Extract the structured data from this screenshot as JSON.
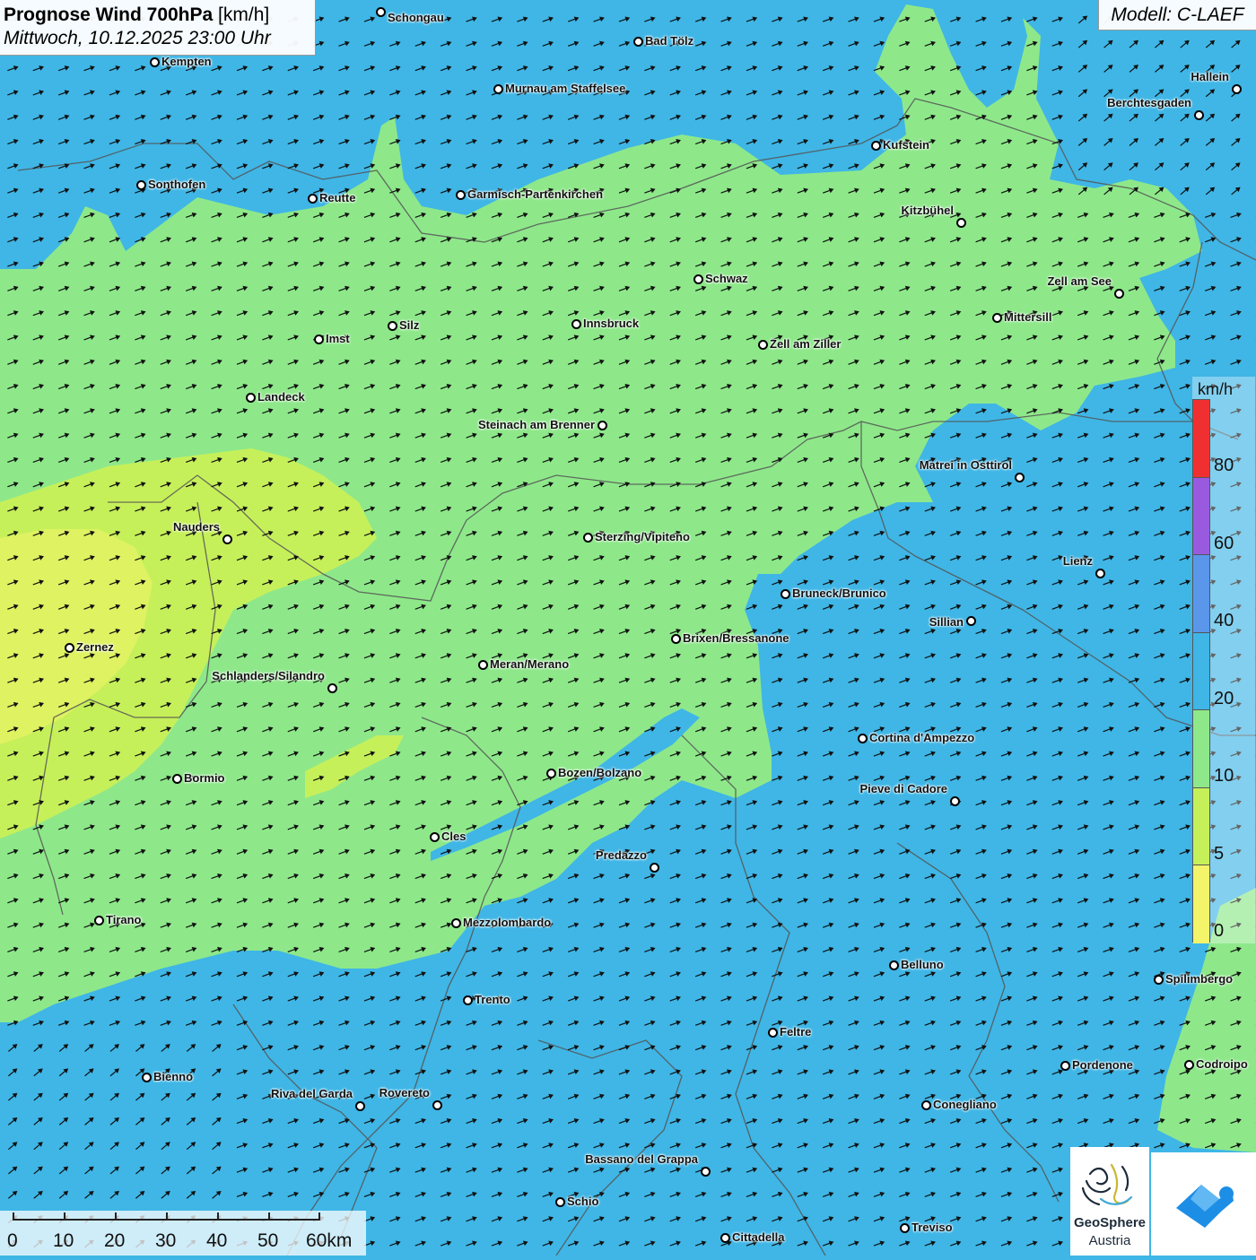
{
  "title": {
    "main": "Prognose Wind 700hPa",
    "unit": "[km/h]",
    "datetime": "Mittwoch, 10.12.2025 23:00 Uhr"
  },
  "model": "Modell: C-LAEF",
  "legend": {
    "unit": "km/h",
    "ticks": [
      "80",
      "60",
      "40",
      "20",
      "10",
      "5",
      "0"
    ],
    "colors": [
      "#f03030",
      "#9a5ae0",
      "#5a96ea",
      "#3fb6e6",
      "#8ee88a",
      "#c6f05a",
      "#f4f46a"
    ]
  },
  "colors": {
    "wind_0_5": "#f4f46a",
    "wind_5_10": "#c6f05a",
    "wind_10_20": "#8ee88a",
    "wind_20_40": "#3fb6e6",
    "arrow": "#111111",
    "border": "#555555"
  },
  "scale": {
    "labels": [
      "0",
      "10",
      "20",
      "30",
      "40",
      "50",
      "60km"
    ]
  },
  "cities": [
    {
      "name": "Schongau"
    },
    {
      "name": "Bad Tölz"
    },
    {
      "name": "Kempten"
    },
    {
      "name": "Murnau am Staffelsee"
    },
    {
      "name": "Hallein"
    },
    {
      "name": "Berchtesgaden"
    },
    {
      "name": "Kufstein"
    },
    {
      "name": "Sonthofen"
    },
    {
      "name": "Reutte"
    },
    {
      "name": "Garmisch-Partenkirchen"
    },
    {
      "name": "Kitzbühel"
    },
    {
      "name": "Schwaz"
    },
    {
      "name": "Zell am See"
    },
    {
      "name": "Mittersill"
    },
    {
      "name": "Innsbruck"
    },
    {
      "name": "Imst"
    },
    {
      "name": "Silz"
    },
    {
      "name": "Zell am Ziller"
    },
    {
      "name": "Landeck"
    },
    {
      "name": "Steinach am Brenner"
    },
    {
      "name": "Matrei in Osttirol"
    },
    {
      "name": "Nauders"
    },
    {
      "name": "Sterzing/Vipiteno"
    },
    {
      "name": "Lienz"
    },
    {
      "name": "Bruneck/Brunico"
    },
    {
      "name": "Sillian"
    },
    {
      "name": "Brixen/Bressanone"
    },
    {
      "name": "Zernez"
    },
    {
      "name": "Meran/Merano"
    },
    {
      "name": "Schlanders/Silandro"
    },
    {
      "name": "Cortina d'Ampezzo"
    },
    {
      "name": "Bozen/Bolzano"
    },
    {
      "name": "Bormio"
    },
    {
      "name": "Pieve di Cadore"
    },
    {
      "name": "Cles"
    },
    {
      "name": "Predazzo"
    },
    {
      "name": "Tirano"
    },
    {
      "name": "Mezzolombardo"
    },
    {
      "name": "Belluno"
    },
    {
      "name": "Spilimbergo"
    },
    {
      "name": "Trento"
    },
    {
      "name": "Feltre"
    },
    {
      "name": "Pordenone"
    },
    {
      "name": "Codroipo"
    },
    {
      "name": "Bienno"
    },
    {
      "name": "Riva del Garda"
    },
    {
      "name": "Rovereto"
    },
    {
      "name": "Conegliano"
    },
    {
      "name": "Bassano del Grappa"
    },
    {
      "name": "Schio"
    },
    {
      "name": "Treviso"
    },
    {
      "name": "Cittadella"
    }
  ],
  "logos": {
    "geosphere_line1": "GeoSphere",
    "geosphere_line2": "Austria"
  }
}
